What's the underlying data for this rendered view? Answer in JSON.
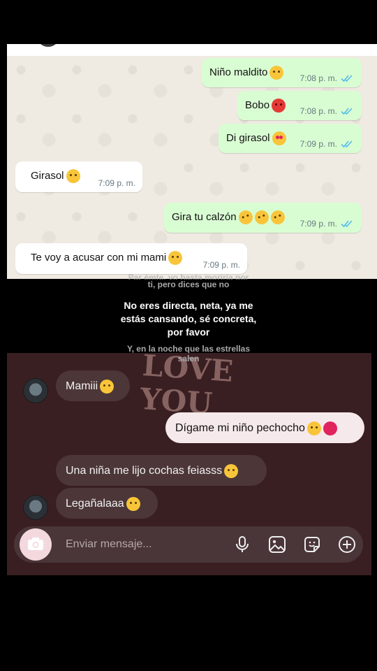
{
  "whatsapp": {
    "messages": [
      {
        "dir": "out",
        "text": "Niño maldito",
        "time": "7:08 p. m.",
        "emoji": "rolling-eyes-icon"
      },
      {
        "dir": "out",
        "text": "Bobo",
        "time": "7:08 p. m.",
        "emoji": "angry-face-icon"
      },
      {
        "dir": "out",
        "text": "Di girasol",
        "time": "7:09 p. m.",
        "emoji": "smiling-face-with-hearts-icon"
      },
      {
        "dir": "in",
        "text": "Girasol",
        "time": "7:09 p. m.",
        "emoji": "disappointed-face-icon"
      },
      {
        "dir": "out",
        "text": "Gira tu calzón",
        "time": "7:09 p. m.",
        "emoji": "rolling-laughing-icon"
      },
      {
        "dir": "in",
        "text": "Te voy a acusar con mi mami",
        "time": "7:09 p. m.",
        "emoji": "unamused-face-icon"
      }
    ]
  },
  "lyrics": {
    "prev_line": "Parcelite, yo hasta moriría por ti, pero dices que no",
    "prev_a": "Par émte, yo hasta moriría por",
    "prev_b": "ti, pero dices que no",
    "current_a": "No eres directa, neta, ya me",
    "current_b": "estás cansando, sé concreta,",
    "current_c": "por favor",
    "next_a": "Y, en la noche que las estrellas",
    "next_b": "salen"
  },
  "instagram": {
    "art_text": "LOVE YOU",
    "messages": [
      {
        "dir": "in",
        "text": "Mamiii",
        "emoji": "loudly-crying-face-icon"
      },
      {
        "dir": "out",
        "text": "Dígame mi niño pechocho",
        "emoji": "pleading-face-icon"
      },
      {
        "dir": "in",
        "text": "Una niña me lijo cochas feiasss",
        "emoji": "disappointed-face-icon"
      },
      {
        "dir": "in",
        "text": "Legañalaaa",
        "emoji": "slightly-frowning-face-icon"
      }
    ],
    "composer_placeholder": "Enviar mensaje..."
  },
  "colors": {
    "wa_out": "#d9fdd3",
    "wa_in": "#ffffff",
    "wa_tick": "#53bdeb",
    "ig_bg": "#3a1f22",
    "ig_in": "#4c3638",
    "ig_out": "#f6e9ec"
  }
}
